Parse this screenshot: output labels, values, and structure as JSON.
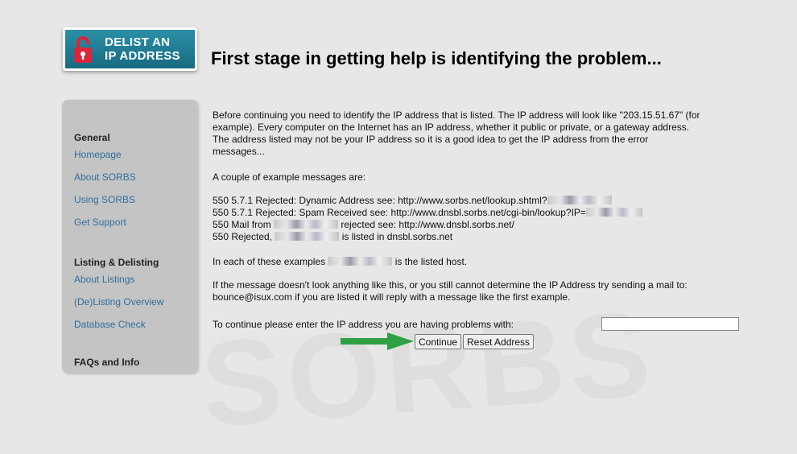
{
  "logo": {
    "line1": "DELIST AN",
    "line2": "IP ADDRESS"
  },
  "page_title": "First stage in getting help is identifying the problem...",
  "sidebar": {
    "sections": [
      {
        "heading": "General",
        "links": [
          "Homepage",
          "About SORBS",
          "Using SORBS",
          "Get Support"
        ]
      },
      {
        "heading": "Listing & Delisting",
        "links": [
          "About Listings",
          "(De)Listing Overview",
          "Database Check"
        ]
      },
      {
        "heading": "FAQs and Info"
      }
    ]
  },
  "content": {
    "intro": [
      "Before continuing you need to identify the IP address that is listed. The IP address will look like \"203.15.51.67\" (for",
      "example). Every computer on the Internet has an IP address, whether it public or private, or a gateway address.",
      "The address listed may not be your IP address so it is a good idea to get the IP address from the error",
      "messages..."
    ],
    "examples_intro": "A couple of example messages are:",
    "examples": [
      {
        "before": "550 5.7.1 Rejected: Dynamic Address see: http://www.sorbs.net/lookup.shtml?",
        "after": ""
      },
      {
        "before": "550 5.7.1 Rejected: Spam Received see: http://www.dnsbl.sorbs.net/cgi-bin/lookup?IP=",
        "after": ""
      },
      {
        "before": "550 Mail from ",
        "after": " rejected see: http://www.dnsbl.sorbs.net/"
      },
      {
        "before": "550 Rejected, ",
        "after": " is listed in dnsbl.sorbs.net"
      }
    ],
    "listed_host_before": "In each of these examples ",
    "listed_host_after": " is the listed host.",
    "fallback": [
      "If the message doesn't look anything like this, or you still cannot determine the IP Address try sending a mail to:",
      "bounce@isux.com if you are listed it will reply with a message like the first example."
    ],
    "form_prompt": "To continue please enter the IP address you are having problems with:",
    "ip_value": "",
    "continue_label": "Continue",
    "reset_label": "Reset Address"
  },
  "watermark": "SORBS",
  "colors": {
    "link": "#2f6f9f",
    "logo_bg": "#1f7f96",
    "arrow": "#2ea043",
    "sidebar_bg": "#c4c4c4",
    "page_bg": "#e7e7e7"
  }
}
